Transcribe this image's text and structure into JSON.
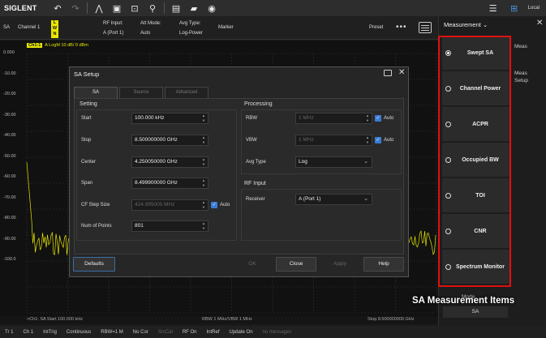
{
  "toolbar": {
    "logo": "SIGLENT",
    "local_label": "Local",
    "icons": [
      "undo-icon",
      "redo-icon",
      "waveform-icon",
      "tb-icon",
      "capture-icon",
      "probe-icon",
      "save-icon",
      "folder-icon",
      "camera-icon",
      "settings-sliders-icon",
      "network-icon"
    ]
  },
  "infobar": {
    "sa_label": "SA",
    "channel_label": "Channel 1",
    "trace_letters": [
      "L",
      "W",
      "N"
    ],
    "rf_input_label": "RF Input:",
    "rf_input_value": "A (Port 1)",
    "att_mode_label": "Att Mode:",
    "att_mode_value": "Auto",
    "avg_type_label": "Avg Type:",
    "avg_type_value": "Log-Power",
    "marker_label": "Marker",
    "preset_label": "Preset",
    "more_label": "•••"
  },
  "plot": {
    "header_tag": "Ch1:1",
    "header_text": "A  LogM  10 dB/  0 dBm",
    "y_ticks": [
      "0.000",
      "-10.00",
      "-20.00",
      "-30.00",
      "-40.00",
      "-50.00",
      "-60.00",
      "-70.00",
      "-80.00",
      "-90.00",
      "-100.0"
    ],
    "trace_color": "#e6e600",
    "bottom_left": ">Ch1: SA Start 100.000 kHz",
    "bottom_center": "RBW 1 MHz/VBW 1 MHz",
    "bottom_right": "Stop 8.500000000 GHz"
  },
  "dialog": {
    "title": "SA Setup",
    "tabs": [
      "SA",
      "Source",
      "Advanced"
    ],
    "setting_group": "Setting",
    "start_label": "Start",
    "start_value": "100.000 kHz",
    "stop_label": "Stop",
    "stop_value": "8.500000000 GHz",
    "center_label": "Center",
    "center_value": "4.250050000 GHz",
    "span_label": "Span",
    "span_value": "8.499900000 GHz",
    "cf_step_label": "CF Step Size",
    "cf_step_value": "424.995000 MHz",
    "cf_auto_label": "Auto",
    "num_points_label": "Num of Points",
    "num_points_value": "801",
    "processing_group": "Processing",
    "rbw_label": "RBW",
    "rbw_value": "1 MHz",
    "rbw_auto_label": "Auto",
    "vbw_label": "VBW",
    "vbw_value": "1 MHz",
    "vbw_auto_label": "Auto",
    "avg_type_label": "Avg Type",
    "avg_type_value": "Log",
    "rf_input_group": "RF Input",
    "receiver_label": "Receiver",
    "receiver_value": "A (Port 1)",
    "defaults_button": "Defaults",
    "ok_button": "OK",
    "close_button": "Close",
    "apply_button": "Apply",
    "help_button": "Help"
  },
  "right_panel": {
    "title": "Measurement",
    "meas_items": [
      "Swept SA",
      "Channel Power",
      "ACPR",
      "Occupied BW",
      "TOI",
      "CNR",
      "Spectrum Monitor"
    ],
    "selected_index": 0,
    "side_tab_meas": "Meas",
    "side_tab_meas_setup": "Meas Setup",
    "mode_label": "Mode",
    "mode_value": "SA",
    "frame_color": "#e01010"
  },
  "caption": "SA Measurement Items",
  "status_bar": [
    "Tr 1",
    "Ch 1",
    "IntTrig",
    "Continuous",
    "RBW=1 M",
    "No Cor",
    "SrcCal",
    "RF On",
    "IntRef",
    "Update On",
    "no messages"
  ]
}
